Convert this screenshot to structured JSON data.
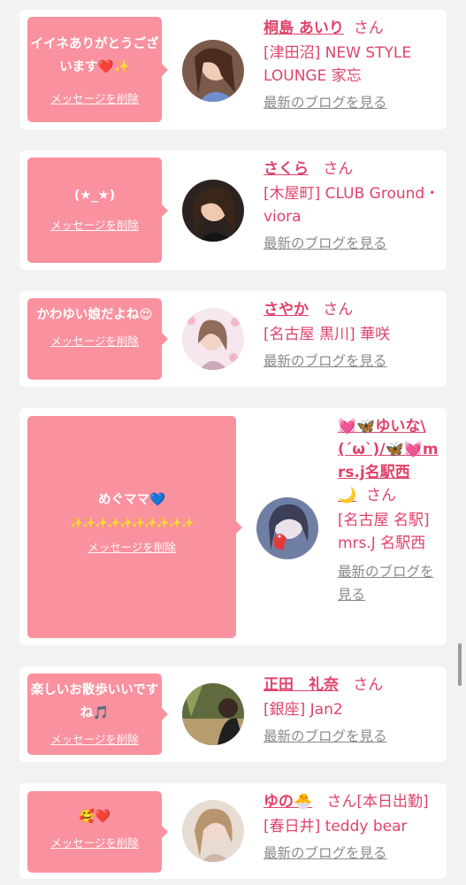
{
  "delete_label": "メッセージを削除",
  "san_label": "さん",
  "blog_label": "最新のブログを見る",
  "colors": {
    "bubble": "#f9919e",
    "name": "#e0436a",
    "link": "#8a8a8a",
    "background": "#f2f2f2"
  },
  "cards": [
    {
      "message": "イイネありがとうございます❤️✨",
      "name": "桐島 あいり",
      "shop": "[津田沼] NEW STYLE LOUNGE 家忘",
      "suffix": ""
    },
    {
      "message": "(★_★)",
      "name": "さくら",
      "shop": "[木屋町] CLUB Ground・viora",
      "suffix": ""
    },
    {
      "message": "かわゆい娘だよね😍",
      "name": "さやか",
      "shop": "[名古屋 黒川] 華咲",
      "suffix": ""
    },
    {
      "message": "めぐママ💙",
      "message2": "✨✨✨✨✨✨✨✨✨✨",
      "name": "💓🦋ゆいな\\(´ω`)/🦋💓mrs.j名駅西🌙",
      "shop": "[名古屋 名駅] mrs.J 名駅西",
      "suffix": ""
    },
    {
      "message": "楽しいお散歩いいですね🎵",
      "name": "正田　礼奈",
      "shop": "[銀座] Jan2",
      "suffix": ""
    },
    {
      "message": "🥰❤️",
      "name": "ゆの🐣",
      "shop": "[春日井] teddy bear",
      "suffix": "[本日出勤]"
    }
  ]
}
